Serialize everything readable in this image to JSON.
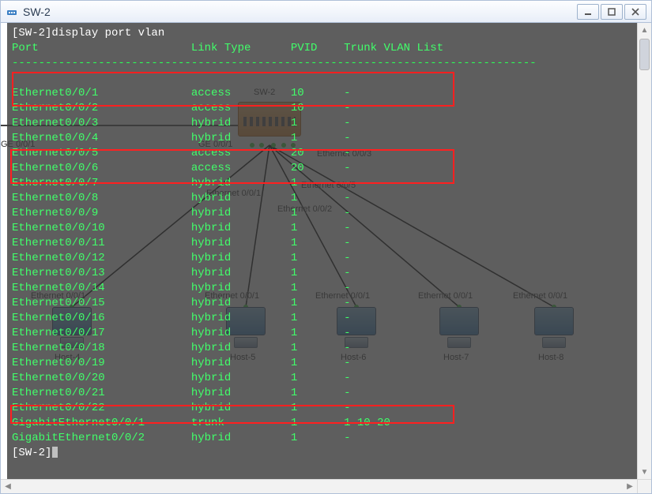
{
  "window": {
    "title": "SW-2"
  },
  "terminal": {
    "command_line": "[SW-2]display port vlan",
    "headers": {
      "port": "Port",
      "link_type": "Link Type",
      "pvid": "PVID",
      "trunk_list": "Trunk VLAN List"
    },
    "divider": "-------------------------------------------------------------------------------",
    "rows": [
      {
        "port": "Ethernet0/0/1",
        "link": "access",
        "pvid": "10",
        "trunk": "-"
      },
      {
        "port": "Ethernet0/0/2",
        "link": "access",
        "pvid": "10",
        "trunk": "-"
      },
      {
        "port": "Ethernet0/0/3",
        "link": "hybrid",
        "pvid": "1",
        "trunk": "-"
      },
      {
        "port": "Ethernet0/0/4",
        "link": "hybrid",
        "pvid": "1",
        "trunk": "-"
      },
      {
        "port": "Ethernet0/0/5",
        "link": "access",
        "pvid": "20",
        "trunk": "-"
      },
      {
        "port": "Ethernet0/0/6",
        "link": "access",
        "pvid": "20",
        "trunk": "-"
      },
      {
        "port": "Ethernet0/0/7",
        "link": "hybrid",
        "pvid": "1",
        "trunk": "-"
      },
      {
        "port": "Ethernet0/0/8",
        "link": "hybrid",
        "pvid": "1",
        "trunk": "-"
      },
      {
        "port": "Ethernet0/0/9",
        "link": "hybrid",
        "pvid": "1",
        "trunk": "-"
      },
      {
        "port": "Ethernet0/0/10",
        "link": "hybrid",
        "pvid": "1",
        "trunk": "-"
      },
      {
        "port": "Ethernet0/0/11",
        "link": "hybrid",
        "pvid": "1",
        "trunk": "-"
      },
      {
        "port": "Ethernet0/0/12",
        "link": "hybrid",
        "pvid": "1",
        "trunk": "-"
      },
      {
        "port": "Ethernet0/0/13",
        "link": "hybrid",
        "pvid": "1",
        "trunk": "-"
      },
      {
        "port": "Ethernet0/0/14",
        "link": "hybrid",
        "pvid": "1",
        "trunk": "-"
      },
      {
        "port": "Ethernet0/0/15",
        "link": "hybrid",
        "pvid": "1",
        "trunk": "-"
      },
      {
        "port": "Ethernet0/0/16",
        "link": "hybrid",
        "pvid": "1",
        "trunk": "-"
      },
      {
        "port": "Ethernet0/0/17",
        "link": "hybrid",
        "pvid": "1",
        "trunk": "-"
      },
      {
        "port": "Ethernet0/0/18",
        "link": "hybrid",
        "pvid": "1",
        "trunk": "-"
      },
      {
        "port": "Ethernet0/0/19",
        "link": "hybrid",
        "pvid": "1",
        "trunk": "-"
      },
      {
        "port": "Ethernet0/0/20",
        "link": "hybrid",
        "pvid": "1",
        "trunk": "-"
      },
      {
        "port": "Ethernet0/0/21",
        "link": "hybrid",
        "pvid": "1",
        "trunk": "-"
      },
      {
        "port": "Ethernet0/0/22",
        "link": "hybrid",
        "pvid": "1",
        "trunk": "-"
      },
      {
        "port": "GigabitEthernet0/0/1",
        "link": "trunk",
        "pvid": "1",
        "trunk": "1 10 20"
      },
      {
        "port": "GigabitEthernet0/0/2",
        "link": "hybrid",
        "pvid": "1",
        "trunk": "-"
      }
    ],
    "prompt": "[SW-2]"
  },
  "topology": {
    "switch_label": "SW-2",
    "left_ge": "GE 0/0/1",
    "right_ge": "GE 0/0/1",
    "host_left": "Host-4",
    "hosts": [
      {
        "name": "Host-5",
        "port": "Ethernet 0/0/1"
      },
      {
        "name": "Host-6",
        "port": "Ethernet 0/0/1"
      },
      {
        "name": "Host-7",
        "port": "Ethernet 0/0/1"
      },
      {
        "name": "Host-8",
        "port": "Ethernet 0/0/1"
      }
    ],
    "sw_port_labels": {
      "eth001": "Ethernet 0/0/1",
      "eth002": "Ethernet 0/0/2",
      "eth003": "Ethernet 0/0/3",
      "eth005": "Ethernet 0/0/5"
    },
    "left_host_port": "Ethernet 0/0/1"
  },
  "colors": {
    "terminal_text": "#41ff6a",
    "highlight_box": "#ff2020",
    "titlebar_text": "#2a3b52",
    "switch_fill": "#e09038"
  }
}
